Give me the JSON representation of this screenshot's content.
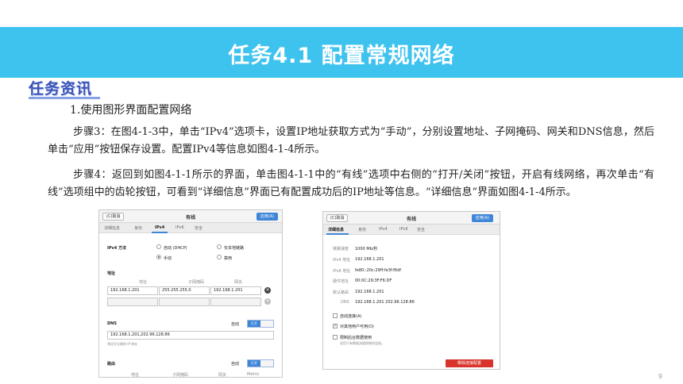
{
  "slide": {
    "title": "任务4.1 配置常规网络",
    "section_tag": "任务资讯",
    "heading": "1.使用图形界面配置网络",
    "para_step3": "步骤3：在图4-1-3中，单击“IPv4”选项卡，设置IP地址获取方式为“手动”，分别设置地址、子网掩码、网关和DNS信息，然后单击“应用”按钮保存设置。配置IPv4等信息如图4-1-4所示。",
    "para_step4": "步骤4：返回到如图4-1-1所示的界面，单击图4-1-1中的“有线”选项中右侧的“打开/关闭”按钮，开启有线网络，再次单击“有线”选项组中的齿轮按钮，可看到“详细信息”界面已有配置成功后的IP地址等信息。“详细信息”界面如图4-1-4所示。",
    "page_number": "9"
  },
  "left_dialog": {
    "cancel_label": "(C)取消",
    "title": "有线",
    "apply_label": "应用(A)",
    "tabs": [
      "详细信息",
      "身份",
      "IPv4",
      "IPv6",
      "安全"
    ],
    "active_tab": "IPv4",
    "ipv4_method_label": "IPv4 方法",
    "methods": {
      "auto_dhcp": "自动 (DHCP)",
      "link_local": "仅本地链路",
      "manual": "手动",
      "disable": "禁用"
    },
    "selected_method": "手动",
    "address_section_label": "地址",
    "address_col_headers": [
      "地址",
      "子网掩码",
      "网关"
    ],
    "address_row": {
      "address": "192.168.1.201",
      "netmask": "255.255.255.0",
      "gateway": "192.168.1.201"
    },
    "dns_label": "DNS",
    "dns_auto_label": "自动",
    "toggle_on_label": "打开",
    "dns_value": "192.168.1.201,202.96.128.86",
    "dns_hint": "将逗号分隔的 IP 地址",
    "routes_label": "路由",
    "routes_auto_label": "自动",
    "route_col_headers": [
      "地址",
      "子网掩码",
      "网关",
      "Metric"
    ]
  },
  "right_dialog": {
    "cancel_label": "(C)取消",
    "title": "有线",
    "apply_label": "应用(A)",
    "tabs": [
      "详细信息",
      "身份",
      "IPv4",
      "IPv6",
      "安全"
    ],
    "active_tab": "详细信息",
    "details": [
      {
        "label": "链路速度",
        "value": "1000 Mb/秒"
      },
      {
        "label": "IPv4 地址",
        "value": "192.168.1.201"
      },
      {
        "label": "IPv6 地址",
        "value": "fe80::20c:29ff:fe3f:f6df"
      },
      {
        "label": "硬件地址",
        "value": "00:0C:29:3F:F6:DF"
      },
      {
        "label": "默认路由",
        "value": "192.168.1.201"
      },
      {
        "label": "DNS",
        "value": "192.168.1.201 202.96.128.86"
      }
    ],
    "options": [
      {
        "label": "自动连接(A)",
        "checked": false
      },
      {
        "label": "对其他用户可用(O)",
        "checked": true
      },
      {
        "label": "限制后台数据使用",
        "checked": false
      }
    ],
    "limit_hint": "适用于有数据流量限制的连接。",
    "remove_button": "移除连接配置"
  }
}
